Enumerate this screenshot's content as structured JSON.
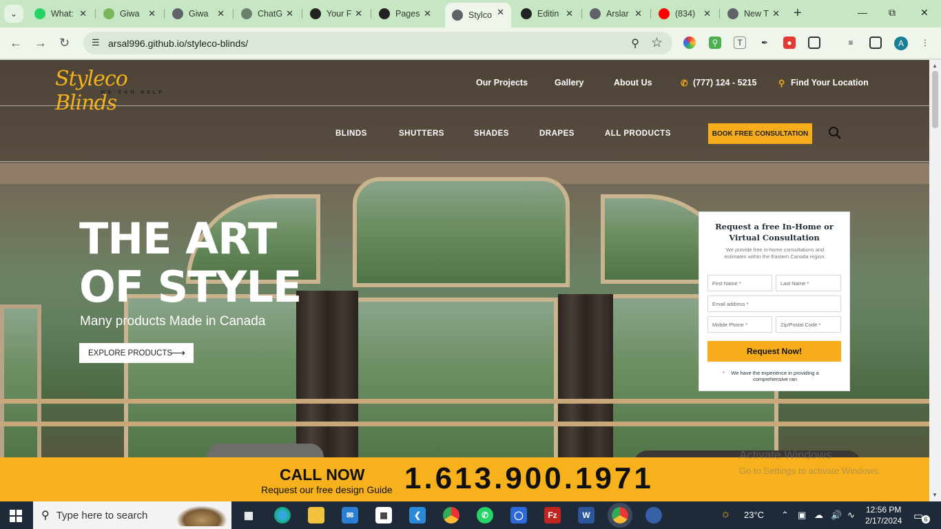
{
  "browser": {
    "tabs": [
      {
        "label": "What:",
        "icon": "whatsapp-icon",
        "color": "#25d366"
      },
      {
        "label": "Giwa",
        "icon": "shopify-icon",
        "color": "#7ab55c"
      },
      {
        "label": "Giwa",
        "icon": "globe-icon",
        "color": "#5f6368"
      },
      {
        "label": "ChatG",
        "icon": "chatgpt-icon",
        "color": "#6b7f6b"
      },
      {
        "label": "Your F",
        "icon": "github-icon",
        "color": "#222222"
      },
      {
        "label": "Pages",
        "icon": "github-icon",
        "color": "#222222"
      },
      {
        "label": "Stylco",
        "icon": "globe-icon",
        "color": "#5f6368",
        "active": true
      },
      {
        "label": "Editin",
        "icon": "github-icon",
        "color": "#222222"
      },
      {
        "label": "Arslar",
        "icon": "globe-icon",
        "color": "#5f6368"
      },
      {
        "label": "(834)",
        "icon": "youtube-icon",
        "color": "#ff0000"
      },
      {
        "label": "New T",
        "icon": "globe-icon",
        "color": "#5f6368"
      }
    ],
    "url": "arsal996.github.io/styleco-blinds/",
    "profile_initial": "A"
  },
  "site": {
    "logo_text": "Styleco Blinds",
    "logo_tagline": "WE CAN HELP",
    "top_nav": {
      "projects": "Our Projects",
      "gallery": "Gallery",
      "about": "About Us",
      "phone": "(777) 124 - 5215",
      "location": "Find Your Location"
    },
    "main_nav": {
      "blinds": "BLINDS",
      "shutters": "SHUTTERS",
      "shades": "SHADES",
      "drapes": "DRAPES",
      "all": "ALL PRODUCTS"
    },
    "cta_label": "BOOK FREE CONSULTATION",
    "accent": "#f6ac1b",
    "hero": {
      "title_line1": "THE ART",
      "title_line2": "OF STYLE",
      "subtitle": "Many products Made in Canada",
      "explore_label": "EXPLORE PRODUCTS"
    },
    "form": {
      "title": "Request a free In-Home or Virtual Consultation",
      "description": "We provide free in-home consultations and estimates within the Eastern Canada region.",
      "first_name_ph": "First Name *",
      "last_name_ph": "Last Name *",
      "email_ph": "Email address *",
      "mobile_ph": "Mobile Phone *",
      "zip_ph": "Zip/Postal Code *",
      "submit_label": "Request Now!",
      "note": "We have the experience in providing a comprehensive ran"
    },
    "call_bar": {
      "call_now": "CALL NOW",
      "subtext": "Request our free design Guide",
      "number": "1.613.900.1971"
    },
    "watermark_line1": "Activate Windows",
    "watermark_line2": "Go to Settings to activate Windows."
  },
  "taskbar": {
    "search_placeholder": "Type here to search",
    "weather": "23°C",
    "time": "12:56 PM",
    "date": "2/17/2024",
    "notifications": "6"
  }
}
